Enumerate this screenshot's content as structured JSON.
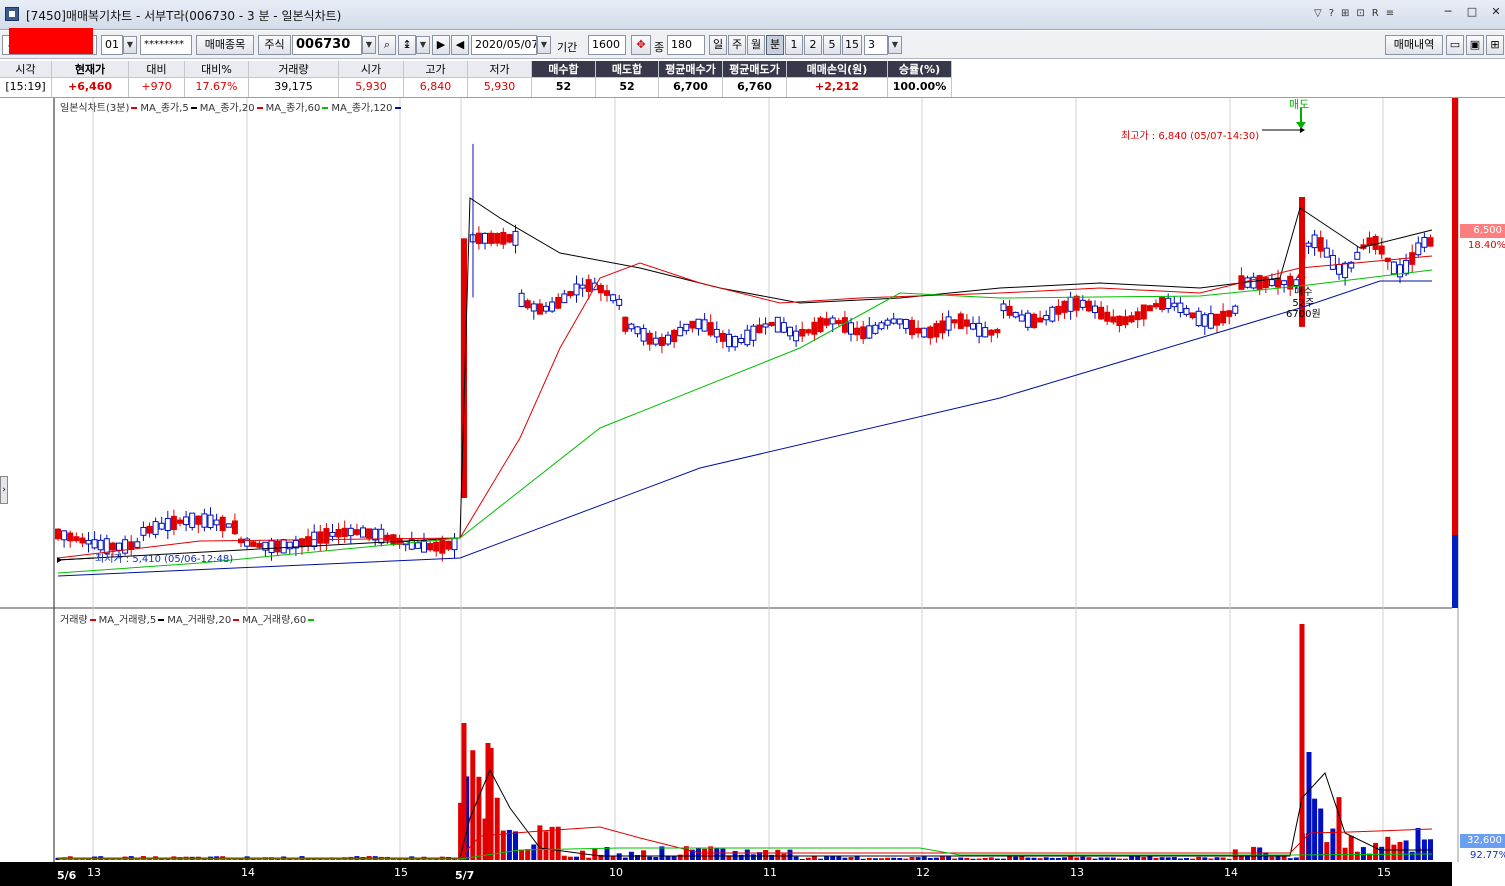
{
  "window": {
    "title": "[7450]매매복기차트 - 서부T라(006730 - 3 분 - 일본식차트)",
    "icons": [
      "pin-icon",
      "help-icon",
      "settings-icon",
      "print-icon",
      "r-icon",
      "tile-icon"
    ],
    "controls": {
      "minimize": "─",
      "maximize": "□",
      "close": "✕"
    }
  },
  "toolbar": {
    "account_num": "01",
    "password": "********",
    "trade_item_btn": "매매종목",
    "market": "주식",
    "code": "006730",
    "date": "2020/05/07",
    "period_label": "기간",
    "period_value": "1600",
    "count_label": "종",
    "count_value": "180",
    "tf_day": "일",
    "tf_week": "주",
    "tf_month": "월",
    "tf_min": "분",
    "tf_1": "1",
    "tf_2": "2",
    "tf_5": "5",
    "tf_15": "15",
    "tf_3": "3",
    "trade_history_btn": "매매내역"
  },
  "info": {
    "time_h": "시각",
    "time_v": "[15:19]",
    "price_h": "현재가",
    "price_v": "+6,460",
    "diff_h": "대비",
    "diff_v": "+970",
    "pct_h": "대비%",
    "pct_v": "17.67%",
    "vol_h": "거래량",
    "vol_v": "39,175",
    "open_h": "시가",
    "open_v": "5,930",
    "high_h": "고가",
    "high_v": "6,840",
    "low_h": "저가",
    "low_v": "5,930",
    "buy_h": "매수합",
    "buy_v": "52",
    "sell_h": "매도합",
    "sell_v": "52",
    "avgbuy_h": "평균매수가",
    "avgbuy_v": "6,700",
    "avgsell_h": "평균매도가",
    "avgsell_v": "6,760",
    "pnl_h": "매매손익(원)",
    "pnl_v": "+2,212",
    "win_h": "승률(%)",
    "win_v": "100.00%"
  },
  "chart": {
    "price_legend": {
      "title": "일본식차트(3분)",
      "ma5": "MA_종가,5",
      "ma20": "MA_종가,20",
      "ma60": "MA_종가,60",
      "ma120": "MA_종가,120"
    },
    "volume_legend": {
      "title": "거래량",
      "ma5": "MA_거래량,5",
      "ma20": "MA_거래량,20",
      "ma60": "MA_거래량,60"
    },
    "high_note": "최고가 : 6,840 (05/07-14:30)",
    "low_note": "최저가 : 5,410 (05/06-12:48)",
    "sell_marker": "매도",
    "buy_marker_1": "매수",
    "buy_marker_2": "52주",
    "buy_marker_3": "6700원",
    "current_price": "6,500",
    "current_pct": "18.40%",
    "current_vol": "32,600",
    "vol_pct": "92.77%",
    "x_labels": [
      {
        "label": "5/6",
        "bold": true
      },
      {
        "label": "13"
      },
      {
        "label": "14"
      },
      {
        "label": "15"
      },
      {
        "label": "5/7",
        "bold": true
      },
      {
        "label": "10"
      },
      {
        "label": "11"
      },
      {
        "label": "12"
      },
      {
        "label": "13"
      },
      {
        "label": "14"
      },
      {
        "label": "15"
      }
    ],
    "colors": {
      "up": "#e00000",
      "down": "#0010c0",
      "ma5": "#000000",
      "ma20": "#e00000",
      "ma60": "#00c000",
      "ma120": "#0010a0"
    }
  }
}
